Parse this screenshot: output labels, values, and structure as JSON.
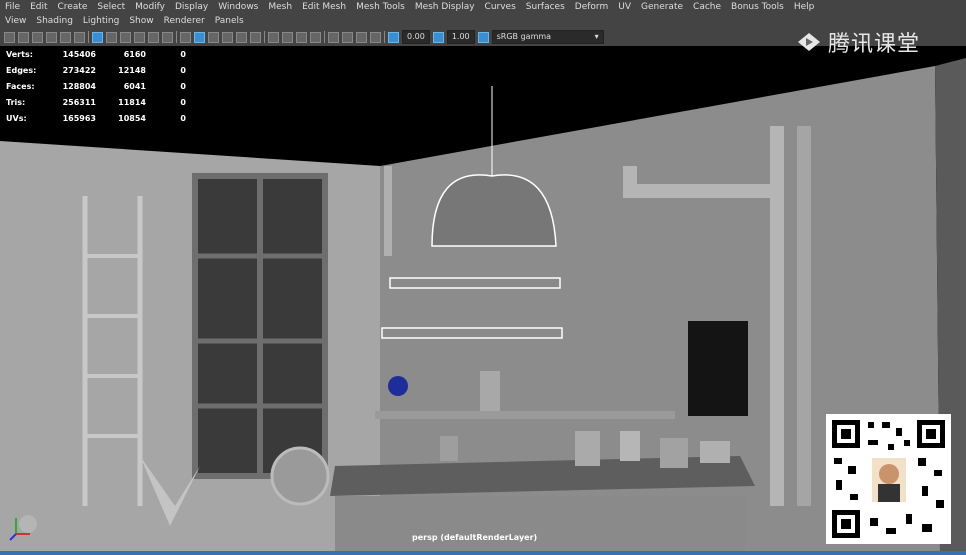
{
  "menu": [
    "File",
    "Edit",
    "Create",
    "Select",
    "Modify",
    "Display",
    "Windows",
    "Mesh",
    "Edit Mesh",
    "Mesh Tools",
    "Mesh Display",
    "Curves",
    "Surfaces",
    "Deform",
    "UV",
    "Generate",
    "Cache",
    "Bonus Tools",
    "Help"
  ],
  "panel_menu": [
    "View",
    "Shading",
    "Lighting",
    "Show",
    "Renderer",
    "Panels"
  ],
  "toolbar": {
    "field_a": "0.00",
    "field_b": "1.00",
    "color_space": "sRGB gamma"
  },
  "hud": [
    {
      "label": "Verts:",
      "a": "145406",
      "b": "6160",
      "c": "0"
    },
    {
      "label": "Edges:",
      "a": "273422",
      "b": "12148",
      "c": "0"
    },
    {
      "label": "Faces:",
      "a": "128804",
      "b": "6041",
      "c": "0"
    },
    {
      "label": "Tris:",
      "a": "256311",
      "b": "11814",
      "c": "0"
    },
    {
      "label": "UVs:",
      "a": "165963",
      "b": "10854",
      "c": "0"
    }
  ],
  "camera_label": "persp (defaultRenderLayer)",
  "watermark": "腾讯课堂",
  "icons": [
    "grid-icon",
    "camera-icon",
    "wireframe-icon",
    "smooth-shade-icon",
    "isolate-icon",
    "color-space-icon",
    "chevron-down-icon"
  ],
  "colors": {
    "accent": "#3b8fd0",
    "bg": "#444444",
    "viewport": "#000000"
  }
}
